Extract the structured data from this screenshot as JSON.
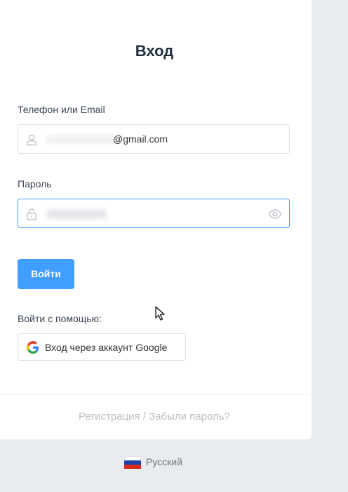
{
  "login": {
    "title": "Вход",
    "phone_email_label": "Телефон или Email",
    "email_value_suffix": "@gmail.com",
    "password_label": "Пароль",
    "submit_label": "Войти",
    "login_with_label": "Войти с помощью:",
    "google_button_label": "Вход через аккаунт Google"
  },
  "footer": {
    "register_link": "Регистрация",
    "separator": "/",
    "forgot_link": "Забыли пароль?"
  },
  "language": {
    "label": "Русский"
  },
  "colors": {
    "primary": "#409eff",
    "focus_border": "#409eff",
    "background": "#e8ecee"
  },
  "icons": [
    "user-icon",
    "lock-icon",
    "eye-icon",
    "google-icon",
    "russia-flag-icon",
    "mouse-cursor-icon"
  ]
}
